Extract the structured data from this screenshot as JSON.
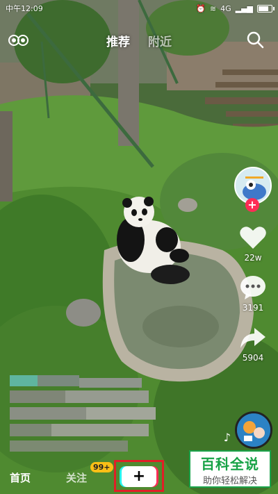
{
  "status_bar": {
    "time": "中午12:09",
    "network": "4G"
  },
  "top_tabs": [
    {
      "label": "推荐"
    },
    {
      "label": "附近"
    }
  ],
  "right_rail": {
    "likes": "22w",
    "comments": "3191",
    "shares": "5904"
  },
  "bottom_nav": {
    "home": "首页",
    "follow": "关注",
    "follow_badge": "99+",
    "create": "+"
  },
  "watermark": {
    "title": "百科全说",
    "subtitle": "助你轻松解决"
  },
  "colors": {
    "accent": "#fe2c55",
    "badge": "#fbbf16",
    "highlight": "#e01f27",
    "watermark_green": "#17a246"
  }
}
